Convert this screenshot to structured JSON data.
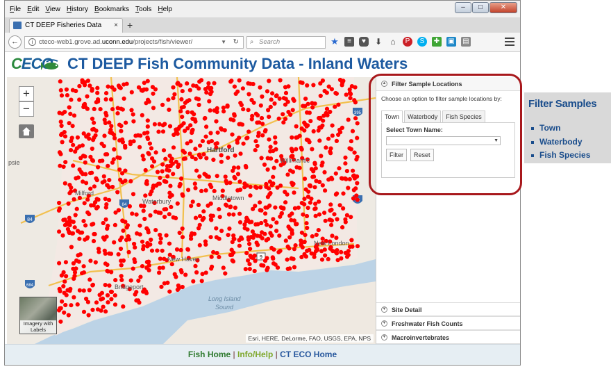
{
  "browser": {
    "menu": [
      "File",
      "Edit",
      "View",
      "History",
      "Bookmarks",
      "Tools",
      "Help"
    ],
    "tab_title": "CT DEEP Fisheries Data",
    "new_tab": "+",
    "url_prefix": "cteco-web1.grove.ad.",
    "url_domain": "uconn.edu",
    "url_path": "/projects/fish/viewer/",
    "search_placeholder": "Search",
    "tab_close": "×",
    "window_controls": {
      "minimize": "–",
      "maximize": "□",
      "close": "✕"
    }
  },
  "header": {
    "logo_c": "C",
    "logo_eco": "ECO",
    "title": "CT DEEP Fish Community Data - Inland Waters"
  },
  "map": {
    "zoom_in": "+",
    "zoom_out": "−",
    "basemap_label": "Imagery with Labels",
    "attribution": "Esri, HERE, DeLorme, FAO, USGS, EPA, NPS",
    "place_labels": {
      "hartford": "Hartford",
      "waterbury": "Waterbury",
      "new_haven": "New Haven",
      "long_island_sound_1": "Long Island",
      "long_island_sound_2": "Sound",
      "bridgeport": "Bridgeport",
      "new_london": "New London",
      "milford": "Milford",
      "psie": "psie",
      "willimantic": "Willimantic",
      "middletown": "Middletown"
    },
    "route_shields": [
      "84",
      "9",
      "395",
      "95",
      "84",
      "684"
    ],
    "sample_color": "#ff0000"
  },
  "side_panel": {
    "filter_header": "Filter Sample Locations",
    "filter_intro": "Choose an option to filter sample locations by:",
    "tabs": [
      "Town",
      "Waterbody",
      "Fish Species"
    ],
    "town_label": "Select Town Name:",
    "town_value": "",
    "filter_button": "Filter",
    "reset_button": "Reset",
    "sections": [
      "Site Detail",
      "Freshwater Fish Counts",
      "Macroinvertebrates"
    ]
  },
  "footer": {
    "fish_home": "Fish Home",
    "info_help": "Info/Help",
    "ct_eco_home": "CT ECO Home",
    "separator": "|"
  },
  "callout": {
    "title": "Filter Samples",
    "items": [
      "Town",
      "Waterbody",
      "Fish Species"
    ]
  }
}
